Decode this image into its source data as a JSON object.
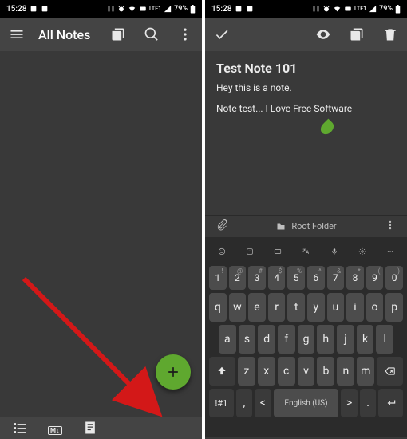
{
  "status": {
    "time": "15:28",
    "battery": "79%",
    "net": "LTE1"
  },
  "left": {
    "title": "All Notes",
    "bottom_md": "M↓"
  },
  "right": {
    "note": {
      "title": "Test Note 101",
      "line1": "Hey this is a note.",
      "line2": "Note test... I Love Free Software"
    },
    "folder": {
      "label": "Root Folder"
    }
  },
  "keyboard": {
    "numrow_alts": [
      "!",
      "@",
      "#",
      "$",
      "%",
      "^",
      "&",
      "*",
      "(",
      ")"
    ],
    "numrow": [
      "1",
      "2",
      "3",
      "4",
      "5",
      "6",
      "7",
      "8",
      "9",
      "0"
    ],
    "row1": [
      "q",
      "w",
      "e",
      "r",
      "t",
      "y",
      "u",
      "i",
      "o",
      "p"
    ],
    "row2": [
      "a",
      "s",
      "d",
      "f",
      "g",
      "h",
      "j",
      "k",
      "l"
    ],
    "row3": [
      "z",
      "x",
      "c",
      "v",
      "b",
      "n",
      "m"
    ],
    "sym": "!#1",
    "comma": ",",
    "space": "English (US)",
    "period": ".",
    "lt": "<",
    "gt": ">"
  }
}
